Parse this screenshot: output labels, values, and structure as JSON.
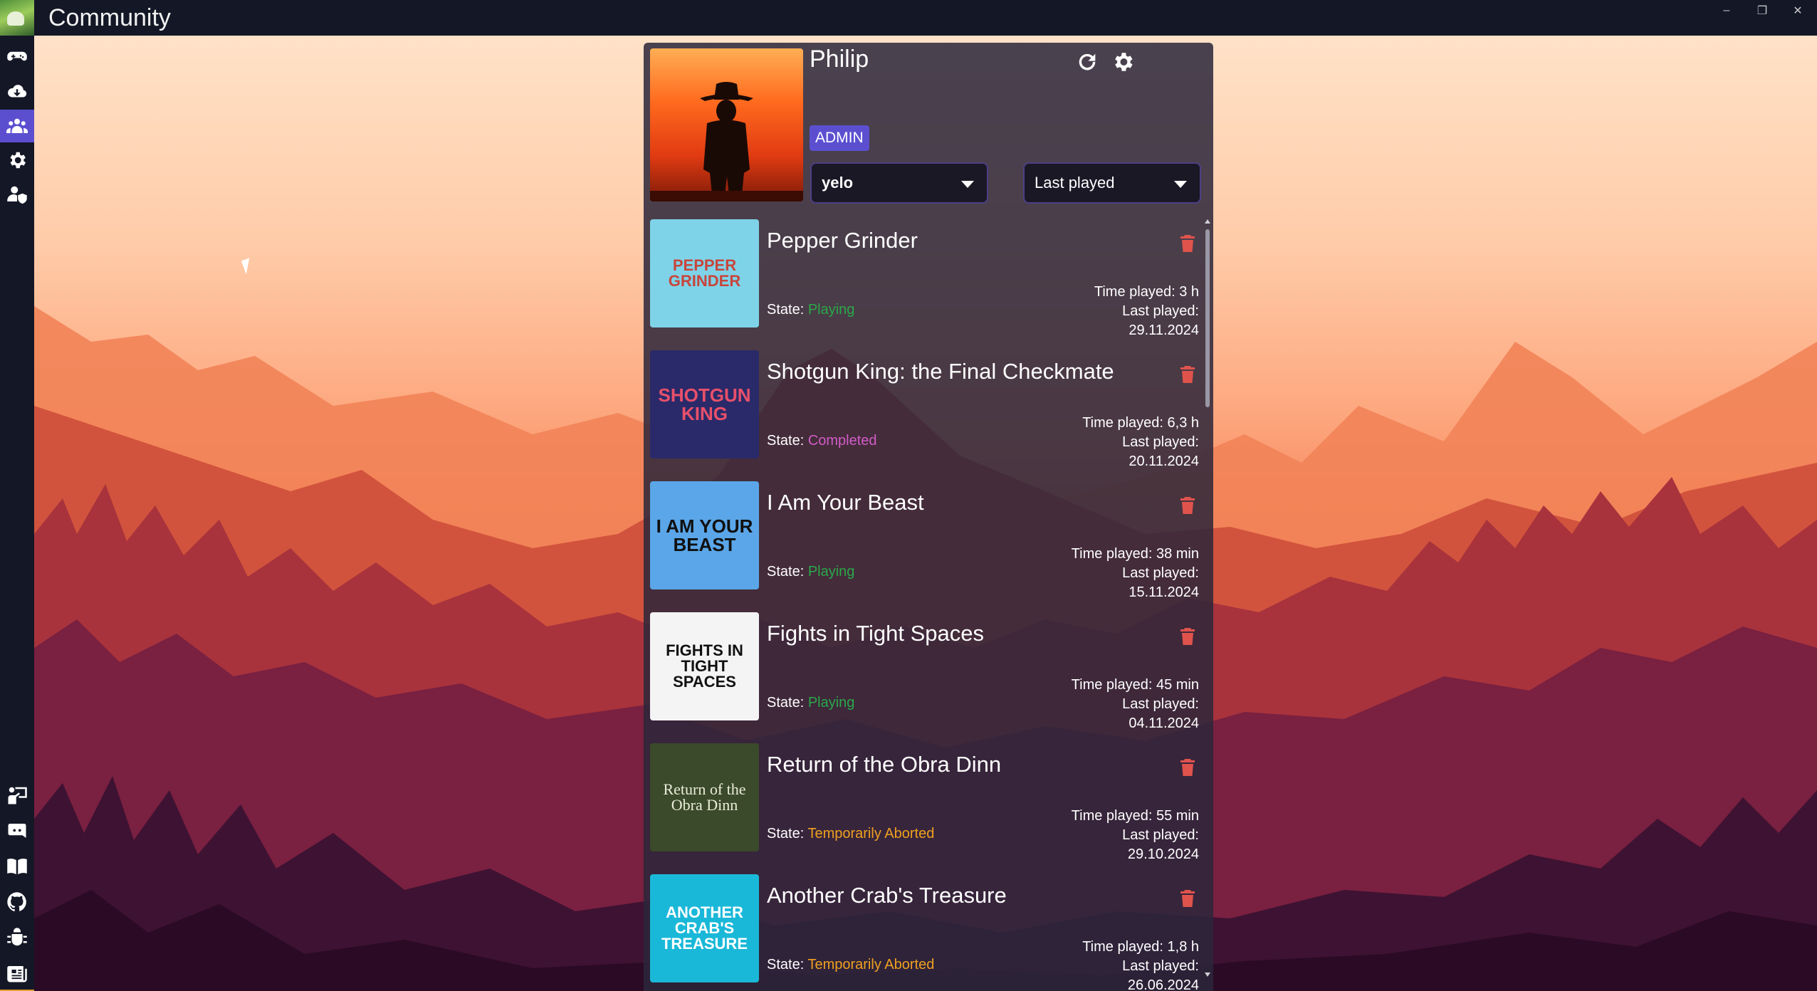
{
  "window": {
    "title": "Community",
    "controls": [
      "–",
      "❐",
      "✕"
    ]
  },
  "sidebar": {
    "top_items": [
      {
        "icon": "gamepad-icon"
      },
      {
        "icon": "cloud-download-icon"
      },
      {
        "icon": "users-icon",
        "active": true
      },
      {
        "icon": "gear-icon"
      },
      {
        "icon": "user-shield-icon"
      }
    ],
    "bottom_items": [
      {
        "icon": "user-presentation-icon"
      },
      {
        "icon": "discord-icon"
      },
      {
        "icon": "book-icon"
      },
      {
        "icon": "github-icon"
      },
      {
        "icon": "bug-icon"
      },
      {
        "icon": "news-icon"
      },
      {
        "icon": "app-cube-icon"
      }
    ]
  },
  "profile": {
    "name": "Philip",
    "badge": "ADMIN",
    "user_select": "yelo",
    "sort_select": "Last played"
  },
  "labels": {
    "state_prefix": "State: ",
    "time_played_prefix": "Time played: ",
    "last_played_prefix": "Last played: "
  },
  "games": [
    {
      "title": "Pepper Grinder",
      "state": "Playing",
      "state_color": "#2aa84a",
      "time_played": "3 h",
      "last_played": "29.11.2024",
      "cover_text": "PEPPER GRINDER",
      "cover_bg": "#7fd3e8",
      "cover_fg": "#c8453c"
    },
    {
      "title": "Shotgun King: the Final Checkmate",
      "state": "Completed",
      "state_color": "#d35cc8",
      "time_played": "6,3 h",
      "last_played": "20.11.2024",
      "cover_text": "SHOTGUN KING",
      "cover_bg": "#2a2a6a",
      "cover_fg": "#e8506a"
    },
    {
      "title": "I Am Your Beast",
      "state": "Playing",
      "state_color": "#2aa84a",
      "time_played": "38 min",
      "last_played": "15.11.2024",
      "cover_text": "I AM YOUR BEAST",
      "cover_bg": "#5aa6e8",
      "cover_fg": "#101010"
    },
    {
      "title": "Fights in Tight Spaces",
      "state": "Playing",
      "state_color": "#2aa84a",
      "time_played": "45 min",
      "last_played": "04.11.2024",
      "cover_text": "FIGHTS IN TIGHT SPACES",
      "cover_bg": "#f4f4f4",
      "cover_fg": "#111111"
    },
    {
      "title": "Return of the Obra Dinn",
      "state": "Temporarily Aborted",
      "state_color": "#f0a020",
      "time_played": "55 min",
      "last_played": "29.10.2024",
      "cover_text": "Return of the Obra Dinn",
      "cover_bg": "#3b4a2a",
      "cover_fg": "#e8ecd8"
    },
    {
      "title": "Another Crab's Treasure",
      "state": "Temporarily Aborted",
      "state_color": "#f0a020",
      "time_played": "1,8 h",
      "last_played": "26.06.2024",
      "cover_text": "ANOTHER CRAB'S TREASURE",
      "cover_bg": "#1ab8d8",
      "cover_fg": "#ffffff"
    }
  ]
}
